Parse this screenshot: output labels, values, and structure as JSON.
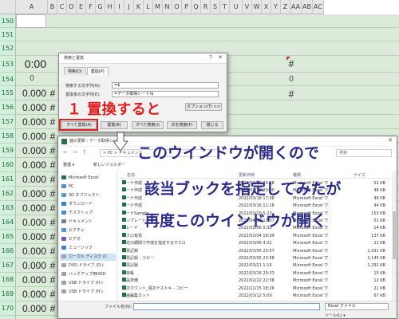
{
  "sheet": {
    "columns": [
      "A",
      "B",
      "C",
      "D",
      "E",
      "F",
      "G",
      "H",
      "I",
      "J",
      "K",
      "L",
      "M",
      "N",
      "O",
      "P",
      "Q",
      "R",
      "S",
      "T",
      "U",
      "V",
      "W",
      "X",
      "Y",
      "Z",
      "AA",
      "AB",
      "AC"
    ],
    "rows": [
      {
        "num": "150",
        "value": "",
        "hash": "",
        "hash_right": ""
      },
      {
        "num": "151",
        "value": "",
        "hash": "",
        "hash_right": ""
      },
      {
        "num": "152",
        "value": "",
        "hash": "",
        "hash_right": ""
      },
      {
        "num": "153",
        "value": "0:00",
        "hash": "",
        "hash_right": "#"
      },
      {
        "num": "154",
        "value": "0",
        "hash": "",
        "hash_right": "0"
      },
      {
        "num": "155",
        "value": "0.000",
        "hash": "#",
        "hash_right": "#"
      },
      {
        "num": "156",
        "value": "0.000",
        "hash": "#",
        "hash_right": ""
      },
      {
        "num": "157",
        "value": "0.000",
        "hash": "#",
        "hash_right": ""
      },
      {
        "num": "158",
        "value": "0.000",
        "hash": "#",
        "hash_right": ""
      },
      {
        "num": "159",
        "value": "0.000",
        "hash": "#",
        "hash_right": ""
      },
      {
        "num": "160",
        "value": "0.000",
        "hash": "#",
        "hash_right": ""
      },
      {
        "num": "161",
        "value": "0.000",
        "hash": "#",
        "hash_right": ""
      },
      {
        "num": "162",
        "value": "0.000",
        "hash": "#",
        "hash_right": ""
      },
      {
        "num": "163",
        "value": "0.000",
        "hash": "#",
        "hash_right": ""
      },
      {
        "num": "164",
        "value": "0.000",
        "hash": "#",
        "hash_right": ""
      },
      {
        "num": "165",
        "value": "0.000",
        "hash": "#",
        "hash_right": ""
      },
      {
        "num": "166",
        "value": "0.000",
        "hash": "#",
        "hash_right": ""
      },
      {
        "num": "167",
        "value": "0.000",
        "hash": "#",
        "hash_right": ""
      },
      {
        "num": "168",
        "value": "0.000",
        "hash": "#",
        "hash_right": ""
      },
      {
        "num": "169",
        "value": "0.000",
        "hash": "#",
        "hash_right": ""
      },
      {
        "num": "170",
        "value": "0.000",
        "hash": "#",
        "hash_right": ""
      },
      {
        "num": "171",
        "value": "0.000",
        "hash": "#",
        "hash_right": ""
      }
    ]
  },
  "find_replace": {
    "title": "検索と置換",
    "help": "?",
    "close": "✕",
    "tab_find": "検索(D)",
    "tab_replace": "置換(P)",
    "find_label": "検索する文字列(N):",
    "find_value": "=$",
    "replace_label": "置換後の文字列(E):",
    "replace_value": "=データ取得シート!$",
    "options": "オプション(T) >>",
    "btn_replace_all": "すべて置換(A)",
    "btn_replace": "置換(R)",
    "btn_find_all": "すべて検索(I)",
    "btn_find_next": "次を検索(F)",
    "btn_close": "閉じる"
  },
  "annotations": {
    "step1": "１ 置換すると",
    "line1": "このウインドウが開くので",
    "line2": "該当ブックを指定してみたが",
    "line3": "再度このウインドウが開く"
  },
  "file_dialog": {
    "title": "値の更新 : データ取得シート",
    "close": "✕",
    "crumb": "> PC > ドキュメント",
    "search_placeholder": "検索",
    "organize": "整理 ▾",
    "new_folder": "新しいフォルダー",
    "nav": [
      {
        "label": "Microsoft Excel",
        "color": "#217346"
      },
      {
        "label": "PC",
        "color": "#4a90d9"
      },
      {
        "label": "3D オブジェクト",
        "color": "#4aa3df"
      },
      {
        "label": "ダウンロード",
        "color": "#2f7fd1"
      },
      {
        "label": "デスクトップ",
        "color": "#3c8fd8"
      },
      {
        "label": "ドキュメント",
        "color": "#6e7f99"
      },
      {
        "label": "ピクチャ",
        "color": "#4a9ad9"
      },
      {
        "label": "ビデオ",
        "color": "#6c5fb5"
      },
      {
        "label": "ミュージック",
        "color": "#3f83d0"
      },
      {
        "label": "ローカル ディスク (C",
        "color": "#9aa3ad"
      },
      {
        "label": "DVD ドライブ (D:)",
        "color": "#9aa3ad"
      },
      {
        "label": "バックアップ用HDD",
        "color": "#9aa3ad"
      },
      {
        "label": "USB ドライブ (H:)",
        "color": "#9aa3ad"
      },
      {
        "label": "USB ドライブ (H:)",
        "color": "#9aa3ad"
      }
    ],
    "columns": {
      "name": "名前",
      "date": "更新日時",
      "type": "種類",
      "size": "サイズ"
    },
    "files": [
      {
        "name": "コード作成",
        "date": "2022/03/25 20:18",
        "type": "Microsoft Excel ワ",
        "size": "52 KB"
      },
      {
        "name": "コード作成",
        "date": "2022/03/19 20:00",
        "type": "Microsoft Excel ワ",
        "size": "48 KB"
      },
      {
        "name": "コード作成",
        "date": "2022/03/18 17:08",
        "type": "Microsoft Excel ワ",
        "size": "49 KB"
      },
      {
        "name": "コード作成",
        "date": "2022/03/16 11:18",
        "type": "Microsoft Excel ワ",
        "size": "44 KB"
      },
      {
        "name": "コードSample",
        "date": "2022/03/20 5:23",
        "type": "Microsoft Excel ワ",
        "size": "153 KB"
      },
      {
        "name": "テンプレート",
        "date": "2022/04/12 13:37",
        "type": "Microsoft Excel ワ",
        "size": "51 KB"
      },
      {
        "name": "トレード",
        "date": "2022/02/06 0:30",
        "type": "Microsoft Excel ワ",
        "size": "14 KB"
      },
      {
        "name": "マクロ有効",
        "date": "2022/03/04 18:09",
        "type": "Microsoft Excel ワ",
        "size": "137 KB"
      },
      {
        "name": "一定の期間で作成を指定するマクロ",
        "date": "2022/03/06 4:22",
        "type": "Microsoft Excel ワ",
        "size": "21 KB"
      },
      {
        "name": "帳票記録",
        "date": "2022/03/05 23:57",
        "type": "Microsoft Excel ワ",
        "size": "2,331 KB"
      },
      {
        "name": "帳票記録 - コピー",
        "date": "2022/03/05 23:58",
        "type": "Microsoft Excel ワ",
        "size": "1,145 KB"
      },
      {
        "name": "帳票記録",
        "date": "2022/03/21 1:15",
        "type": "Microsoft Excel ワ",
        "size": "1,291 KB"
      },
      {
        "name": "出荷帳",
        "date": "2022/03/16 20:33",
        "type": "Microsoft Excel ワ",
        "size": "15 KB"
      },
      {
        "name": "商品単価",
        "date": "2022/02/22 22:58",
        "type": "Microsoft Excel ワ",
        "size": "12 KB"
      },
      {
        "name": "週次カウント_週次テストキ - コピー",
        "date": "2022/12/15 18:26",
        "type": "Microsoft Excel ワ",
        "size": "21 KB"
      },
      {
        "name": "動画編集カット",
        "date": "2022/03/12 5:09",
        "type": "Microsoft Excel ワ",
        "size": "67 KB"
      }
    ],
    "filename_label": "ファイル名(N):",
    "filename_value": "",
    "filetype": "Excel ファイル",
    "tools": "ツール(L) ▾"
  }
}
